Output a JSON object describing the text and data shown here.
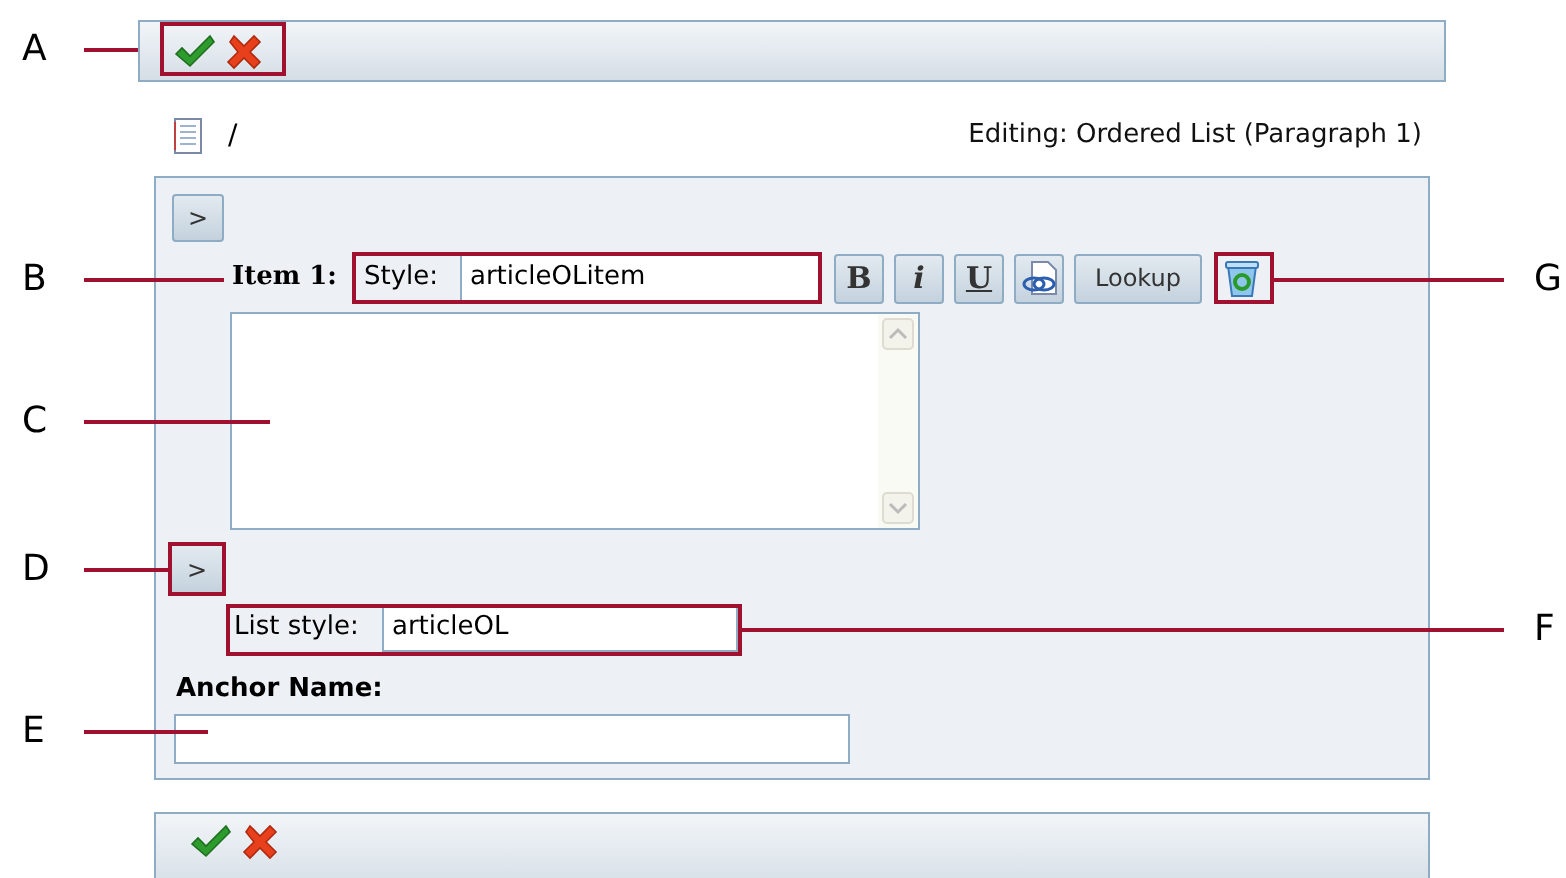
{
  "top_toolbar": {
    "actions": [
      {
        "kind": "ok"
      },
      {
        "kind": "cancel"
      }
    ]
  },
  "breadcrumb": {
    "path": "/",
    "editing": "Editing: Ordered List (Paragraph 1)"
  },
  "item": {
    "label": "Item 1:",
    "style_label": "Style:",
    "style_value": "articleOLitem",
    "buttons": [
      {
        "kind": "bold",
        "label": "B"
      },
      {
        "kind": "italic",
        "label": "i"
      },
      {
        "kind": "underline",
        "label": "U"
      },
      {
        "kind": "link"
      },
      {
        "kind": "text",
        "label": "Lookup"
      },
      {
        "kind": "delete"
      }
    ]
  },
  "list_style": {
    "label": "List style:",
    "value": "articleOL"
  },
  "anchor": {
    "label": "Anchor Name:"
  },
  "bottom_toolbar": {
    "actions": [
      {
        "kind": "ok"
      },
      {
        "kind": "cancel"
      }
    ]
  },
  "expand_buttons": [
    {
      "label": ">"
    },
    {
      "label": ">"
    }
  ],
  "callouts": [
    {
      "letter": "A"
    },
    {
      "letter": "B"
    },
    {
      "letter": "G"
    },
    {
      "letter": "C"
    },
    {
      "letter": "D"
    },
    {
      "letter": "F"
    },
    {
      "letter": "E"
    }
  ]
}
